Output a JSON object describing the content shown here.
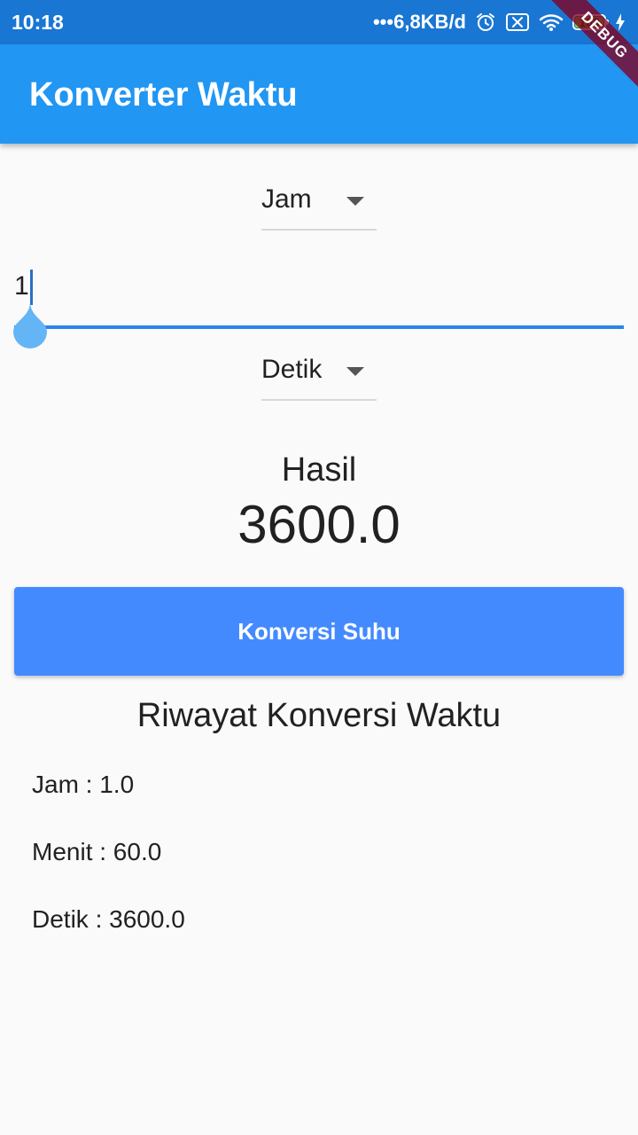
{
  "status_bar": {
    "time": "10:18",
    "network_speed": "•••6,8KB/d",
    "battery": "100",
    "battery_level": 1.0
  },
  "debug_banner": "DEBUG",
  "app_bar": {
    "title": "Konverter Waktu"
  },
  "from_unit": {
    "selected": "Jam"
  },
  "input": {
    "value": "1"
  },
  "to_unit": {
    "selected": "Detik"
  },
  "result": {
    "label": "Hasil",
    "value": "3600.0"
  },
  "convert_button": {
    "label": "Konversi Suhu"
  },
  "history": {
    "title": "Riwayat Konversi Waktu",
    "items": [
      "Jam : 1.0",
      "Menit : 60.0",
      "Detik : 3600.0"
    ]
  },
  "colors": {
    "status_bar": "#1976d2",
    "app_bar": "#2196f3",
    "button": "#448aff",
    "input_underline": "#2a86e8",
    "handle": "#64b5f6"
  }
}
